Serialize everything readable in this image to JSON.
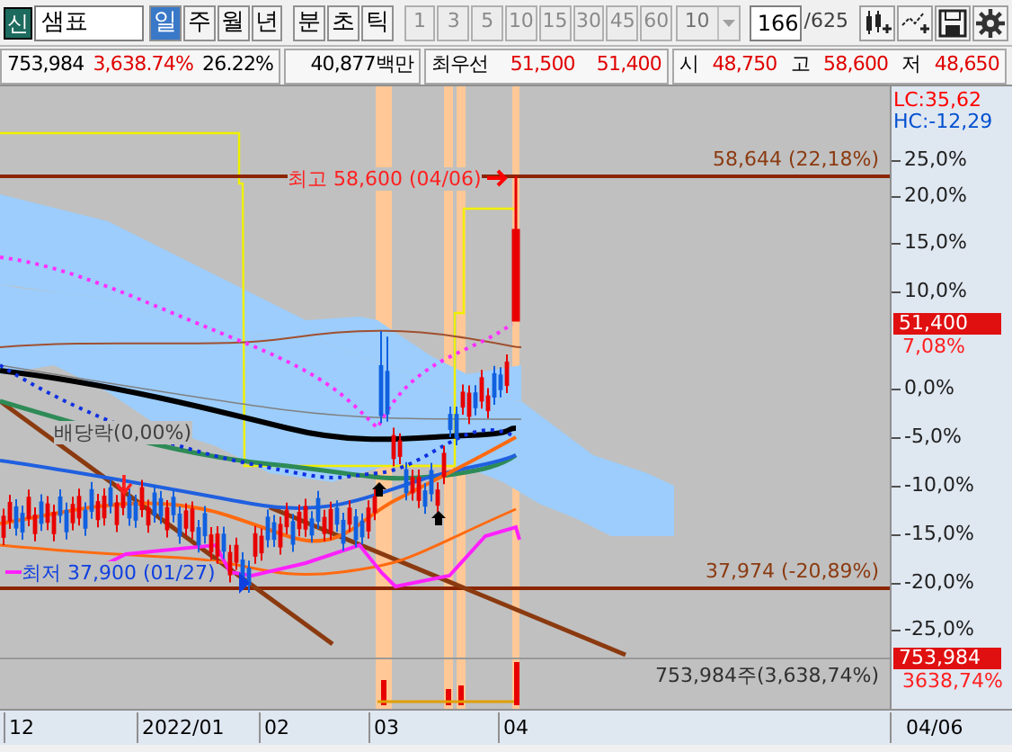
{
  "symbol": {
    "badge": "신",
    "name": "샘표"
  },
  "periods": [
    {
      "label": "일",
      "selected": true
    },
    {
      "label": "주",
      "selected": false
    },
    {
      "label": "월",
      "selected": false
    },
    {
      "label": "년",
      "selected": false
    }
  ],
  "units": [
    {
      "label": "분",
      "selected": false
    },
    {
      "label": "초",
      "selected": false
    },
    {
      "label": "틱",
      "selected": false
    }
  ],
  "intervals": [
    {
      "label": "1",
      "disabled": true
    },
    {
      "label": "3",
      "disabled": true
    },
    {
      "label": "5",
      "disabled": true
    },
    {
      "label": "10",
      "disabled": true
    },
    {
      "label": "15",
      "disabled": true
    },
    {
      "label": "30",
      "disabled": true
    },
    {
      "label": "45",
      "disabled": true
    },
    {
      "label": "60",
      "disabled": true
    }
  ],
  "interval_select": {
    "value": "10"
  },
  "page": {
    "value": "166",
    "total": "/625"
  },
  "quote_bar": {
    "volume": "753,984",
    "volume_change": "3,638.74%",
    "turnover": "26.22%",
    "amount": "40,877백만",
    "best_label": "최우선",
    "best_ask": "51,500",
    "best_bid": "51,400",
    "open_label": "시",
    "open": "48,750",
    "high_label": "고",
    "high": "58,600",
    "low_label": "저",
    "low": "48,650"
  },
  "chart": {
    "indicators": [
      {
        "text": "LC:35,62",
        "color": "#ff0000"
      },
      {
        "text": "HC:-12,29",
        "color": "#0050d0"
      }
    ],
    "y_ticks": [
      "25,0%",
      "20,0%",
      "15,0%",
      "10,0%",
      "0,0%",
      "-5,0%",
      "-10,0%",
      "-15,0%",
      "-20,0%",
      "-25,0%"
    ],
    "current_price": "51,400",
    "current_change": "7,08%",
    "high_line_label": "58,644 (22,18%)",
    "high_marker": "최고 58,600 (04/06)",
    "low_line_label": "37,974 (-20,89%)",
    "low_marker": "최저 37,900 (01/27)",
    "dividend_label": "배당락(0,00%)",
    "volume_label": "753,984주(3,638,74%)",
    "volume_badge": "753,984",
    "volume_change": "3638,74%",
    "x_labels": [
      "12",
      "2022/01",
      "02",
      "03",
      "04"
    ],
    "last_date": "04/06"
  }
}
